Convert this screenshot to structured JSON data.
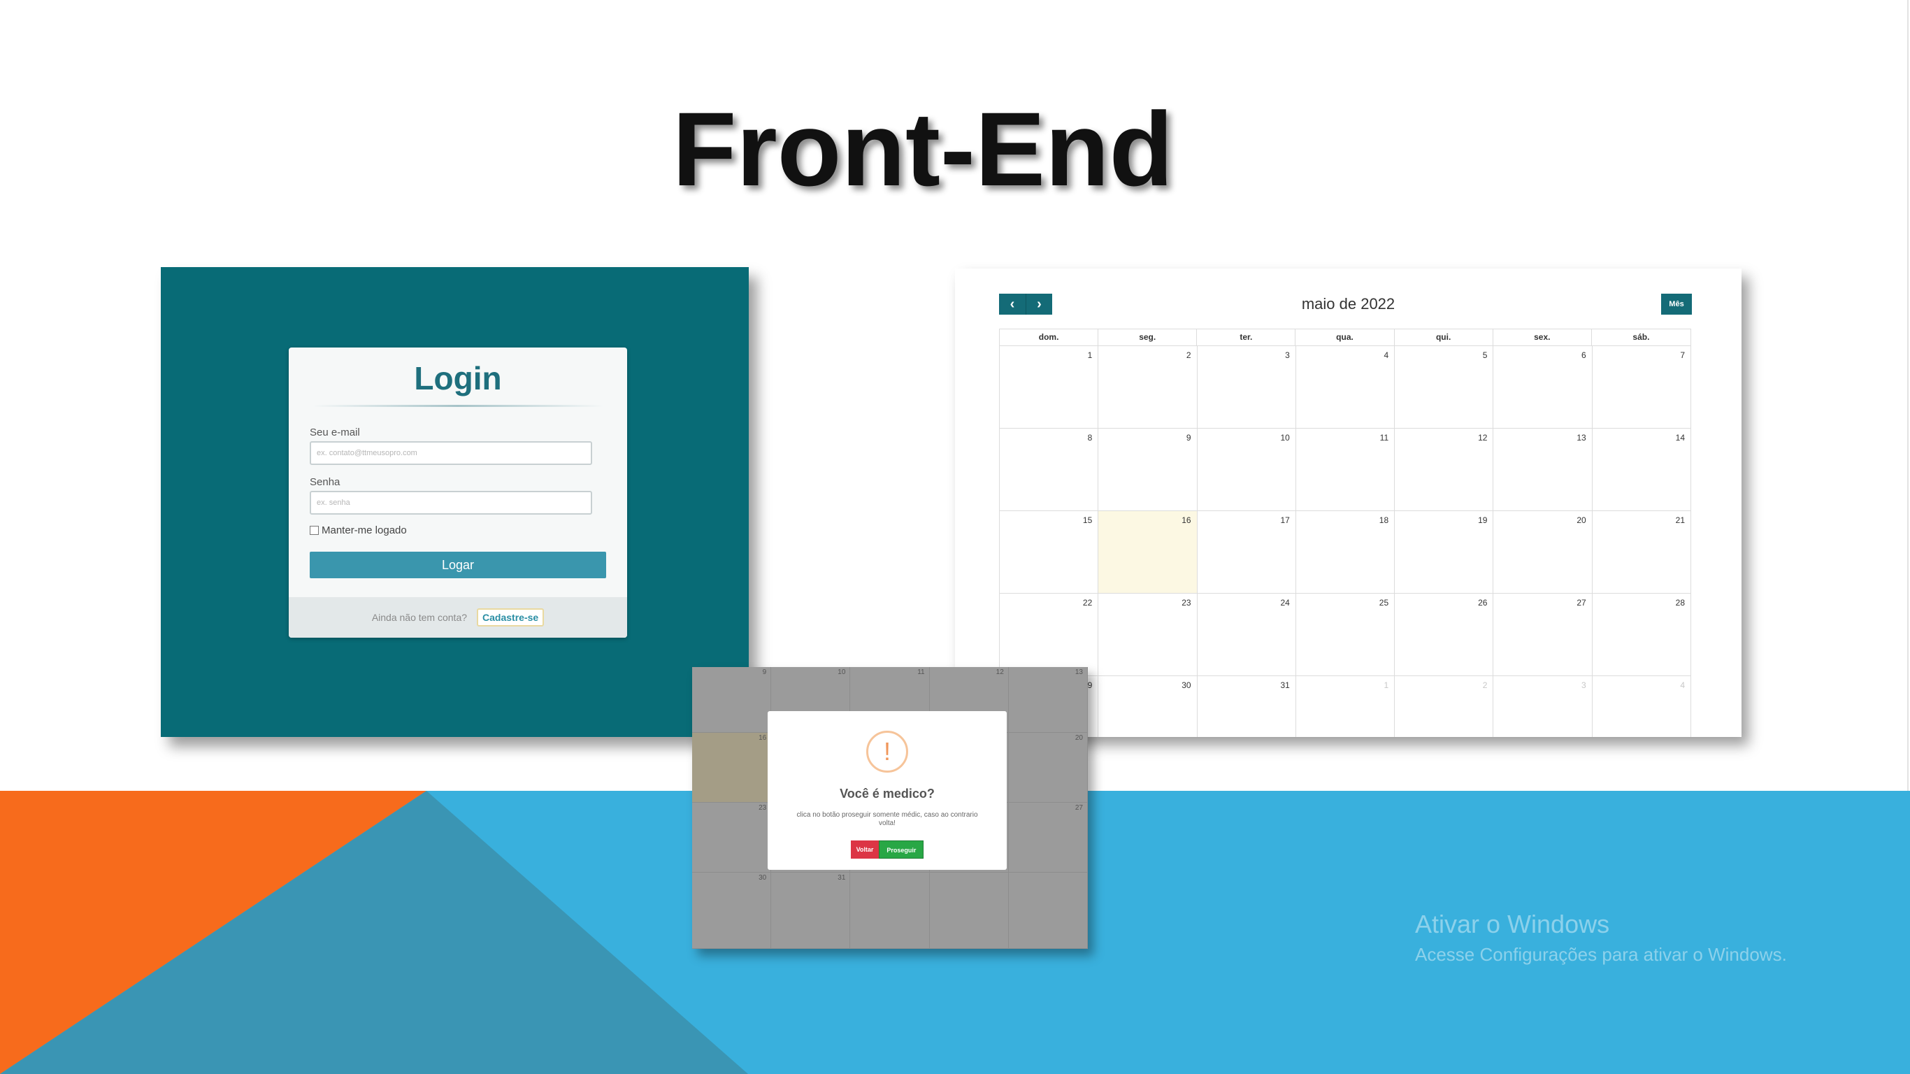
{
  "slide": {
    "title": "Front-End",
    "colors": {
      "orange": "#f76b1c",
      "teal": "#3a95b4",
      "blue": "#39b0dd"
    }
  },
  "login": {
    "heading": "Login",
    "email_label": "Seu e-mail",
    "email_placeholder": "ex. contato@ttmeusopro.com",
    "password_label": "Senha",
    "password_placeholder": "ex. senha",
    "remember_label": "Manter-me logado",
    "submit_label": "Logar",
    "signup_question": "Ainda não tem conta?",
    "signup_link": "Cadastre-se",
    "colors": {
      "background": "#086b76",
      "button": "#3a96ad"
    }
  },
  "calendar": {
    "title": "maio de 2022",
    "prev_icon": "chevron-left",
    "next_icon": "chevron-right",
    "month_button": "Mês",
    "weekdays": [
      "dom.",
      "seg.",
      "ter.",
      "qua.",
      "qui.",
      "sex.",
      "sáb."
    ],
    "weeks": [
      [
        "1",
        "2",
        "3",
        "4",
        "5",
        "6",
        "7"
      ],
      [
        "8",
        "9",
        "10",
        "11",
        "12",
        "13",
        "14"
      ],
      [
        "15",
        "16",
        "17",
        "18",
        "19",
        "20",
        "21"
      ],
      [
        "22",
        "23",
        "24",
        "25",
        "26",
        "27",
        "28"
      ],
      [
        "29",
        "30",
        "31",
        "1",
        "2",
        "3",
        "4"
      ]
    ],
    "today": "16"
  },
  "modal": {
    "icon": "exclamation-icon",
    "title": "Você é medico?",
    "text": "clica no botão proseguir somente médic, caso ao contrario volta!",
    "back_label": "Voltar",
    "continue_label": "Proseguir",
    "background_days": [
      [
        "9",
        "10",
        "11",
        "12",
        "13"
      ],
      [
        "16",
        "",
        "",
        "",
        "20"
      ],
      [
        "23",
        "",
        "",
        "",
        "27"
      ],
      [
        "30",
        "31",
        "",
        "",
        ""
      ]
    ]
  },
  "watermark": {
    "line1": "Ativar o Windows",
    "line2": "Acesse Configurações para ativar o Windows."
  }
}
